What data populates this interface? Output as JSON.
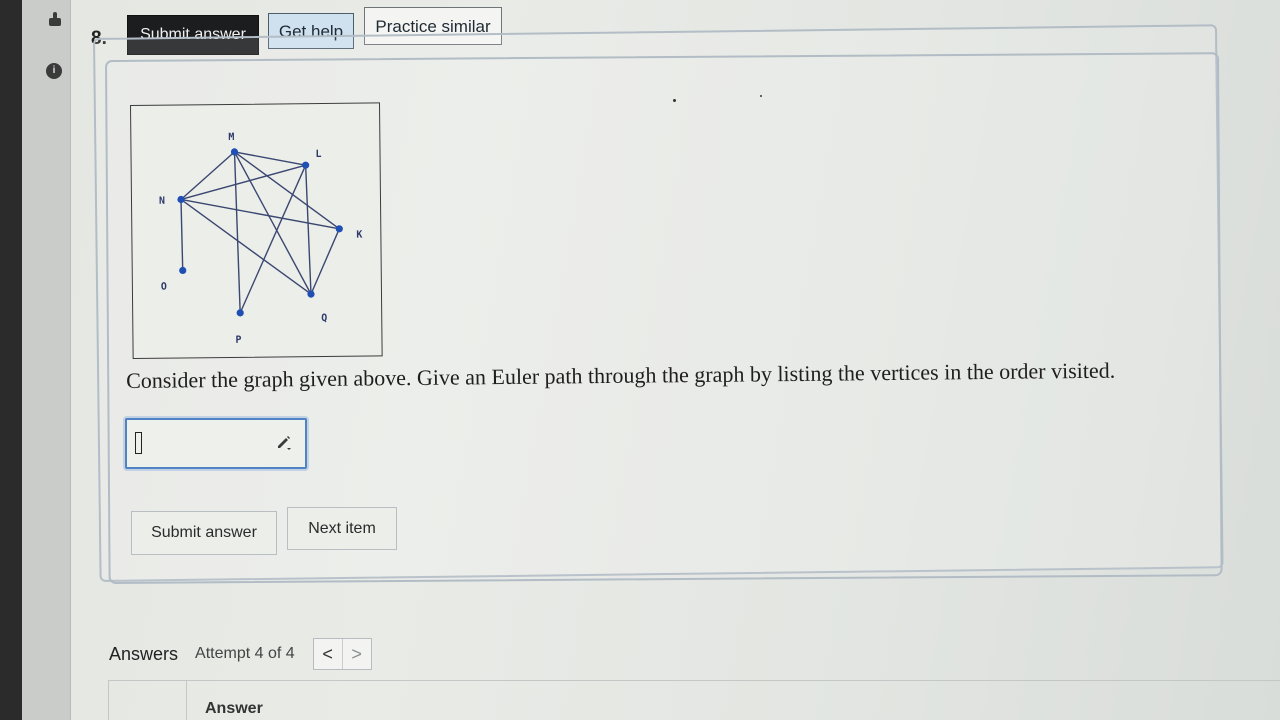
{
  "question": {
    "number": "8.",
    "text": "Consider the graph given above. Give an Euler path through the graph by listing the vertices in the order visited."
  },
  "toolbar": {
    "submit_label": "Submit answer",
    "help_label": "Get help",
    "practice_label": "Practice similar"
  },
  "graph": {
    "vertices": [
      "M",
      "L",
      "N",
      "K",
      "O",
      "P",
      "Q"
    ],
    "edges": [
      [
        "M",
        "L"
      ],
      [
        "M",
        "N"
      ],
      [
        "M",
        "K"
      ],
      [
        "M",
        "P"
      ],
      [
        "M",
        "Q"
      ],
      [
        "L",
        "N"
      ],
      [
        "L",
        "P"
      ],
      [
        "L",
        "Q"
      ],
      [
        "N",
        "O"
      ],
      [
        "N",
        "K"
      ],
      [
        "N",
        "Q"
      ],
      [
        "K",
        "Q"
      ]
    ]
  },
  "answer_input": {
    "value": "",
    "icon": "pencil-icon"
  },
  "actions": {
    "submit_label": "Submit answer",
    "next_label": "Next item"
  },
  "answers": {
    "title": "Answers",
    "attempt": "Attempt 4 of 4",
    "prev_icon": "<",
    "next_icon": ">",
    "column_header": "Answer"
  },
  "rail": {
    "icons": [
      "hand-icon",
      "info-icon"
    ]
  }
}
